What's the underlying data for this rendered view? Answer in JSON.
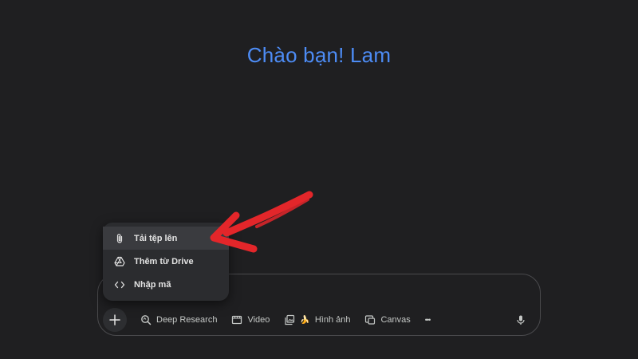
{
  "greeting": "Chào bạn! Lam",
  "attach_menu": {
    "items": [
      {
        "label": "Tải tệp lên",
        "icon": "paperclip-icon"
      },
      {
        "label": "Thêm từ Drive",
        "icon": "drive-icon"
      },
      {
        "label": "Nhập mã",
        "icon": "code-icon"
      }
    ]
  },
  "toolbar": {
    "deep_research": "Deep Research",
    "video": "Video",
    "image": "Hình ảnh",
    "image_emoji": "🍌",
    "canvas": "Canvas",
    "more": "•••"
  },
  "colors": {
    "background": "#1f1f21",
    "greeting": "#4d8cf5",
    "annotation_arrow": "#e3262a"
  }
}
